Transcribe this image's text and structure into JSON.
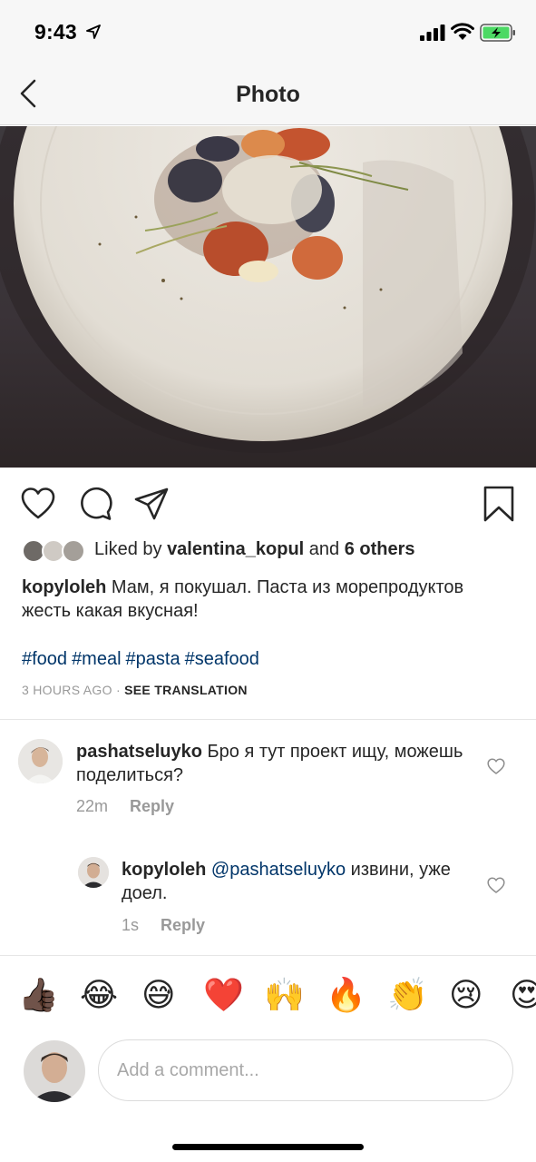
{
  "status_bar": {
    "time": "9:43",
    "icons": [
      "location-arrow-icon",
      "signal-bars-icon",
      "wifi-icon",
      "battery-charging-icon"
    ]
  },
  "nav": {
    "title": "Photo",
    "back_icon": "chevron-left-icon"
  },
  "post": {
    "actions": [
      "heart-icon",
      "comment-icon",
      "share-icon",
      "bookmark-icon"
    ],
    "likes": {
      "prefix": "Liked by ",
      "user": "valentina_kopul",
      "middle": " and ",
      "others": "6 others"
    },
    "caption": {
      "user": "kopyloleh",
      "text": " Мам, я покушал. Паста из морепродуктов жесть какая вкусная!"
    },
    "hashtags": [
      "#food",
      "#meal",
      "#pasta",
      "#seafood"
    ],
    "time_ago": "3 HOURS AGO",
    "separator": " · ",
    "see_translation": "SEE TRANSLATION"
  },
  "comments": [
    {
      "user": "pashatseluyko",
      "text": " Бро я тут проект ищу, можешь поделиться?",
      "time": "22m",
      "reply_label": "Reply"
    },
    {
      "user": "kopyloleh",
      "mention": "@pashatseluyko",
      "text": " извини, уже доел.",
      "time": "1s",
      "reply_label": "Reply"
    }
  ],
  "emoji_bar": [
    "👍🏿",
    "😂",
    "😅",
    "❤️",
    "🙌",
    "🔥",
    "👏",
    "😢",
    "😍"
  ],
  "composer": {
    "placeholder": "Add a comment..."
  },
  "colors": {
    "link_blue": "#003569",
    "muted_gray": "#999999",
    "text": "#262626"
  }
}
